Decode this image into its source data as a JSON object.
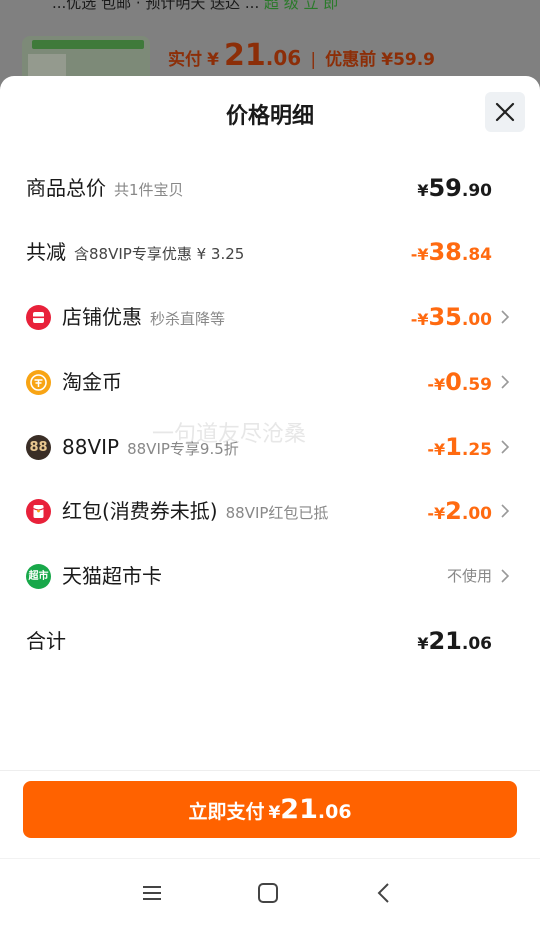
{
  "background": {
    "top_line": "...优选 包邮 · 预计明天 送达 ...",
    "top_line_green": "超 级 立 即",
    "product_strip": "",
    "paid_label": "实付",
    "paid_currency": "¥",
    "paid_int": "21",
    "paid_dec": ".06",
    "before_label": "优惠前",
    "before_value": "¥59.9"
  },
  "sheet": {
    "title": "价格明细"
  },
  "rows": [
    {
      "label": "商品总价",
      "sub": "共1件宝贝",
      "currency": "¥",
      "int": "59",
      "dec": ".90",
      "color": "#1a1a1a",
      "chevron": false
    },
    {
      "label": "共减",
      "sub": "含88VIP专享优惠 ¥ 3.25",
      "currency": "-¥",
      "int": "38",
      "dec": ".84",
      "color": "#ff6a10",
      "chevron": false
    },
    {
      "label": "店铺优惠",
      "sub": "秒杀直降等",
      "currency": "-¥",
      "int": "35",
      "dec": ".00",
      "color": "#ff6a10",
      "chevron": true,
      "icon": "shop-discount-icon"
    },
    {
      "label": "淘金币",
      "sub": "",
      "currency": "-¥",
      "int": "0",
      "dec": ".59",
      "color": "#ff6a10",
      "chevron": true,
      "icon": "taojinbi-coin-icon"
    },
    {
      "label": "88VIP",
      "sub": "88VIP专享9.5折",
      "currency": "-¥",
      "int": "1",
      "dec": ".25",
      "color": "#ff6a10",
      "chevron": true,
      "icon": "vip88-icon"
    },
    {
      "label": "红包(消费券未抵)",
      "sub": "88VIP红包已抵",
      "currency": "-¥",
      "int": "2",
      "dec": ".00",
      "color": "#ff6a10",
      "chevron": true,
      "icon": "red-packet-icon"
    },
    {
      "label": "天猫超市卡",
      "sub": "",
      "text_value": "不使用",
      "chevron": true,
      "icon": "tmall-supermarket-icon"
    },
    {
      "label": "合计",
      "sub": "",
      "currency": "¥",
      "int": "21",
      "dec": ".06",
      "color": "#1a1a1a",
      "chevron": false
    }
  ],
  "pay_button": {
    "label": "立即支付",
    "currency": "¥",
    "int": "21",
    "dec": ".06"
  },
  "watermark": "一句道友尽沧桑",
  "icons": {
    "vip88_text": "88",
    "supermarket_text": "超市"
  },
  "colors": {
    "accent": "#ff6200",
    "discount": "#ff6a10",
    "shop_icon": "#e8213a",
    "coin_icon": "#f8a414",
    "vip_icon": "#3a2e26",
    "redpacket_icon": "#e8213a",
    "supermarket_icon": "#18a84a"
  }
}
